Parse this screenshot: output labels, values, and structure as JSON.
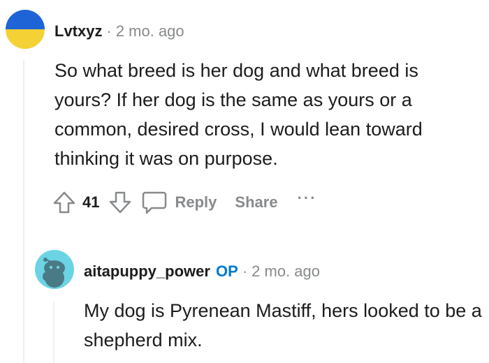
{
  "comment": {
    "author": "Lvtxyz",
    "separator": "·",
    "time": "2 mo. ago",
    "body": "So what breed is her dog and what breed is yours? If her dog is the same as yours or a common, desired cross, I would lean toward thinking it was on purpose.",
    "upvote_icon": "arrow-up-icon",
    "vote_count": "41",
    "downvote_icon": "arrow-down-icon",
    "reply_icon": "speech-bubble-icon",
    "reply_label": "Reply",
    "share_label": "Share",
    "more_label": "···",
    "avatar_colors": [
      "#1f64d6",
      "#f4d135"
    ]
  },
  "reply": {
    "author": "aitapuppy_power",
    "op_badge": "OP",
    "separator": "·",
    "time": "2 mo. ago",
    "body": "My dog is Pyrenean Mastiff, hers looked to be a shepherd mix.",
    "avatar_color": "#6ad4e4"
  }
}
